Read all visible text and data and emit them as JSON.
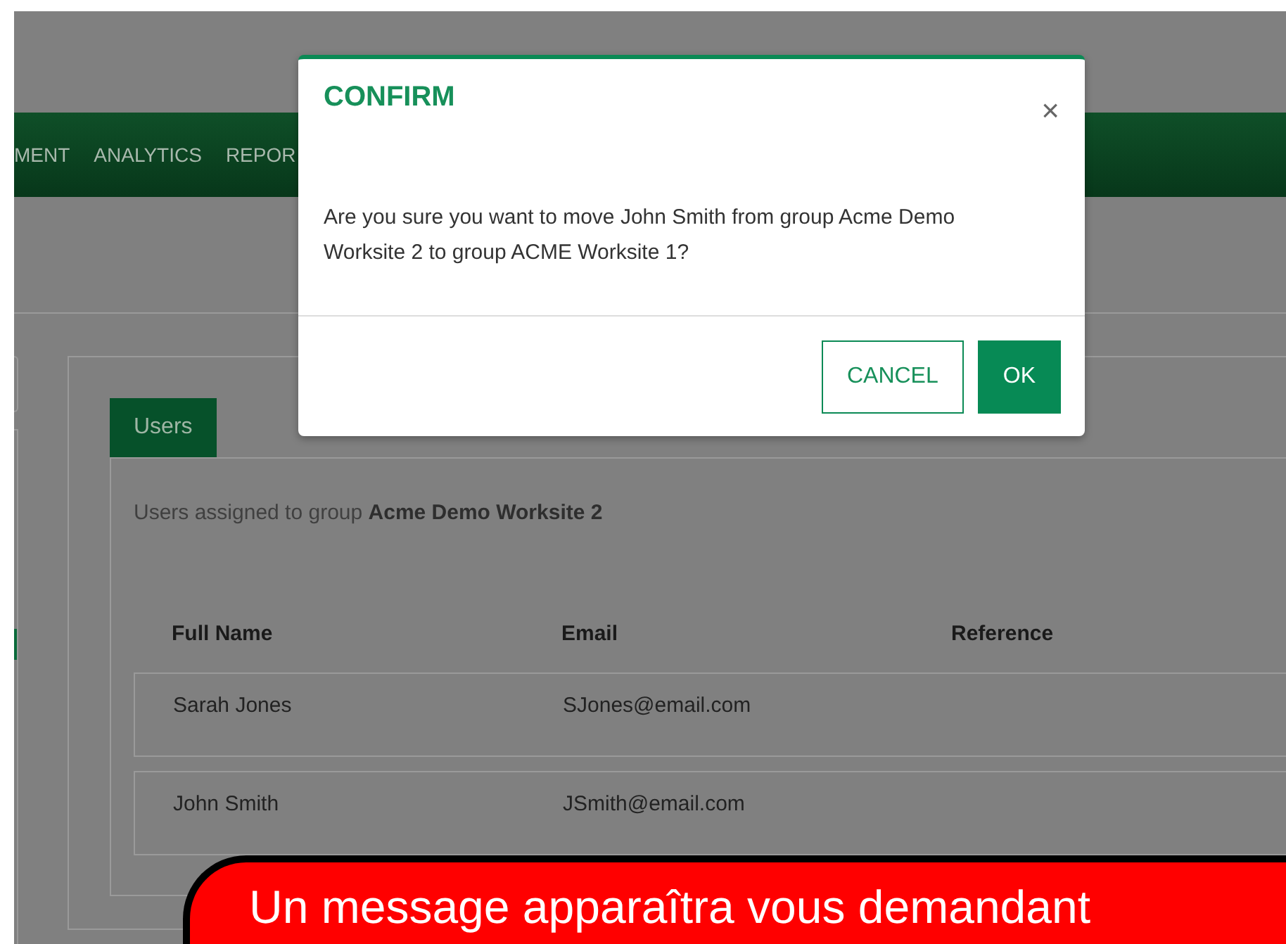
{
  "nav": {
    "items": [
      {
        "label": "MENT"
      },
      {
        "label": "ANALYTICS"
      },
      {
        "label": "REPOR"
      }
    ]
  },
  "panel": {
    "tabs": [
      {
        "label": "Users",
        "selected": true
      }
    ],
    "intro": "Users assigned to group **Acme Demo Worksite 2**",
    "table": {
      "columns": [
        "Full Name",
        "Email",
        "Reference"
      ],
      "rows": [
        {
          "name": "Sarah Jones",
          "email": "SJones@email.com"
        },
        {
          "name": "John Smith",
          "email": "JSmith@email.com"
        }
      ]
    }
  },
  "dialog": {
    "title": "CONFIRM",
    "close": "×",
    "message": "Are you sure you want to move John Smith from group Acme Demo Worksite 2 to group ACME Worksite 1?",
    "buttons": [
      {
        "label": "CANCEL",
        "kind": "secondary"
      },
      {
        "label": "OK",
        "kind": "primary"
      }
    ]
  },
  "callout": {
    "text": "Un message apparaîtra vous demandant"
  }
}
